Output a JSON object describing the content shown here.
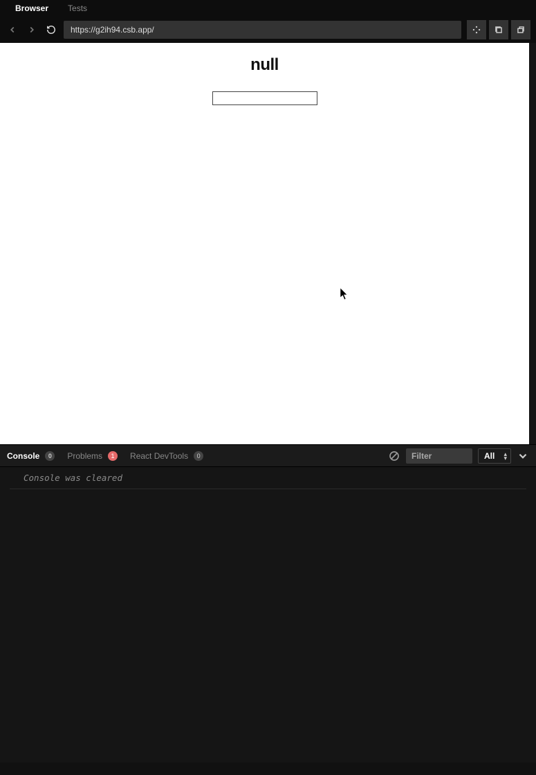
{
  "top_tabs": {
    "browser": "Browser",
    "tests": "Tests"
  },
  "toolbar": {
    "url": "https://g2ih94.csb.app/"
  },
  "page": {
    "heading": "null",
    "input_value": ""
  },
  "devtools": {
    "tabs": {
      "console": {
        "label": "Console",
        "count": "0"
      },
      "problems": {
        "label": "Problems",
        "count": "1"
      },
      "react": {
        "label": "React DevTools",
        "count": "0"
      }
    },
    "filter_placeholder": "Filter",
    "level_selected": "All"
  },
  "console": {
    "cleared_message": "Console was cleared"
  }
}
